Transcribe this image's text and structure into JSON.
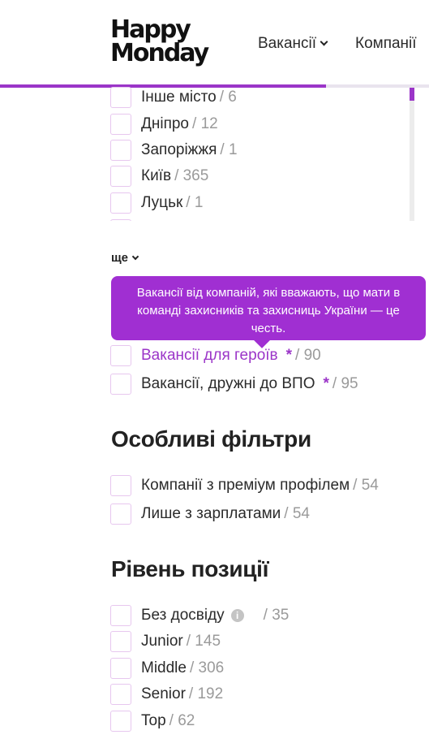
{
  "header": {
    "logo_line1": "Happy",
    "logo_line2": "Monday",
    "nav": [
      {
        "label": "Вакансії"
      },
      {
        "label": "Компанії"
      }
    ],
    "progress_fraction": 0.76
  },
  "cities": [
    {
      "label": "Інше місто",
      "count": "/ 6"
    },
    {
      "label": "Дніпро",
      "count": "/ 12"
    },
    {
      "label": "Запоріжжя",
      "count": "/ 1"
    },
    {
      "label": "Київ",
      "count": "/ 365"
    },
    {
      "label": "Луцьк",
      "count": "/ 1"
    }
  ],
  "more_label": "ще",
  "tooltip": "Вакансії від компаній, які вважають, що мати в команді захисників та захисниць України — це честь.",
  "special_vacancies": [
    {
      "label": "Вакансії для героїв",
      "star": "*",
      "count": "/ 90"
    },
    {
      "label": "Вакансії, дружні до ВПО",
      "star": "*",
      "count": "/ 95"
    }
  ],
  "special_filters": {
    "title": "Особливі фільтри",
    "items": [
      {
        "label": "Компанії з преміум профілем",
        "count": "/ 54"
      },
      {
        "label": "Лише з зарплатами",
        "count": "/ 54"
      }
    ]
  },
  "levels": {
    "title": "Рівень позиції",
    "items": [
      {
        "label": "Без досвіду",
        "count": "/ 35",
        "info": "i"
      },
      {
        "label": "Junior",
        "count": "/ 145"
      },
      {
        "label": "Middle",
        "count": "/ 306"
      },
      {
        "label": "Senior",
        "count": "/ 192"
      },
      {
        "label": "Top",
        "count": "/ 62"
      }
    ]
  },
  "colors": {
    "accent": "#9b35c8",
    "tooltip_bg": "#a02fd2",
    "checkbox_border": "#e7c7ef",
    "count_text": "#9a9a9a"
  }
}
